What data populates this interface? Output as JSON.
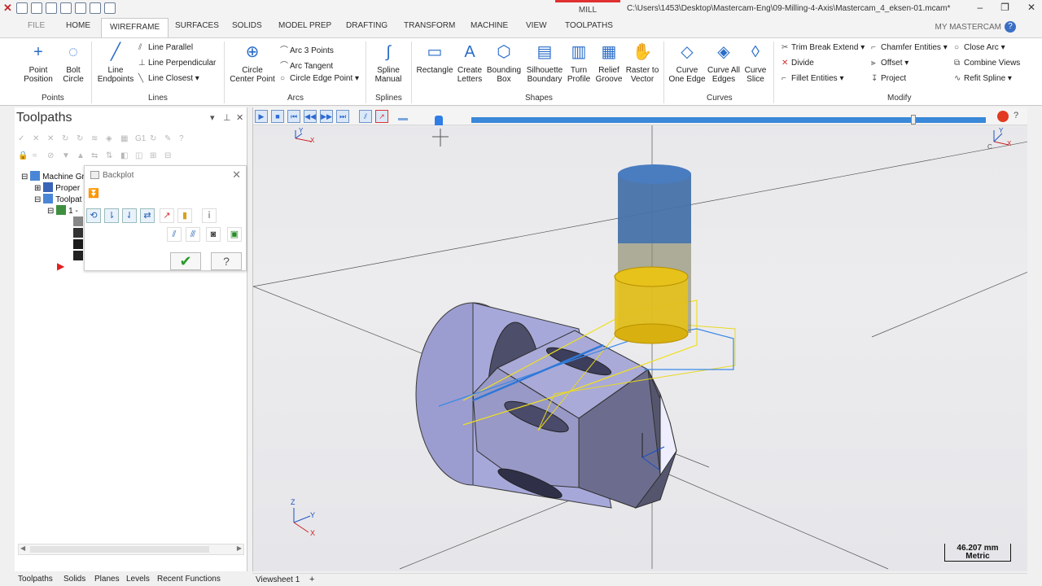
{
  "titlebar": {
    "active_context": "MILL",
    "file_path": "C:\\Users\\1453\\Desktop\\Mastercam-Eng\\09-Milling-4-Axis\\Mastercam_4_eksen-01.mcam*",
    "window_buttons": [
      "–",
      "❐",
      "✕"
    ]
  },
  "tabs": [
    "FILE",
    "HOME",
    "WIREFRAME",
    "SURFACES",
    "SOLIDS",
    "MODEL PREP",
    "DRAFTING",
    "TRANSFORM",
    "MACHINE",
    "VIEW",
    "TOOLPATHS"
  ],
  "active_tab": "WIREFRAME",
  "my_mastercam": "MY MASTERCAM",
  "ribbon": {
    "points": {
      "point_position": "Point\nPosition",
      "bolt_circle": "Bolt\nCircle",
      "group": "Points"
    },
    "lines": {
      "line_endpoints": "Line\nEndpoints",
      "line_parallel": "Line Parallel",
      "line_perpendicular": "Line Perpendicular",
      "line_closest": "Line Closest",
      "group": "Lines"
    },
    "arcs": {
      "circle_center_point": "Circle\nCenter Point",
      "arc_3_points": "Arc 3 Points",
      "arc_tangent": "Arc Tangent",
      "circle_edge_point": "Circle Edge Point",
      "group": "Arcs"
    },
    "splines": {
      "spline_manual": "Spline\nManual",
      "group": "Splines"
    },
    "shapes": {
      "rectangle": "Rectangle",
      "create_letters": "Create\nLetters",
      "bounding_box": "Bounding\nBox",
      "silhouette_boundary": "Silhouette\nBoundary",
      "turn_profile": "Turn\nProfile",
      "relief_groove": "Relief\nGroove",
      "raster_to_vector": "Raster to\nVector",
      "group": "Shapes"
    },
    "curves": {
      "curve_one_edge": "Curve\nOne Edge",
      "curve_all_edges": "Curve All\nEdges",
      "curve_slice": "Curve\nSlice",
      "group": "Curves"
    },
    "modify": {
      "trim_break_extend": "Trim Break Extend",
      "divide": "Divide",
      "fillet_entities": "Fillet Entities",
      "chamfer_entities": "Chamfer Entities",
      "offset": "Offset",
      "project": "Project",
      "close_arc": "Close Arc",
      "combine_views": "Combine Views",
      "refit_spline": "Refit Spline",
      "group": "Modify"
    }
  },
  "toolpaths_panel": {
    "title": "Toolpaths",
    "tree": [
      "Machine Gr",
      "Proper",
      "Toolpat",
      "1 -"
    ],
    "bottom_tabs": [
      "Toolpaths",
      "Solids",
      "Planes",
      "Levels",
      "Recent Functions"
    ]
  },
  "backplot": {
    "title": "Backplot"
  },
  "viewport": {
    "progress_fraction": 1.0,
    "scale_value": "46.207 mm",
    "scale_units": "Metric",
    "viewsheet": "Viewsheet 1",
    "add_viewsheet": "+",
    "axis_labels": {
      "x": "X",
      "y": "Y",
      "z": "Z",
      "c": "C"
    }
  }
}
